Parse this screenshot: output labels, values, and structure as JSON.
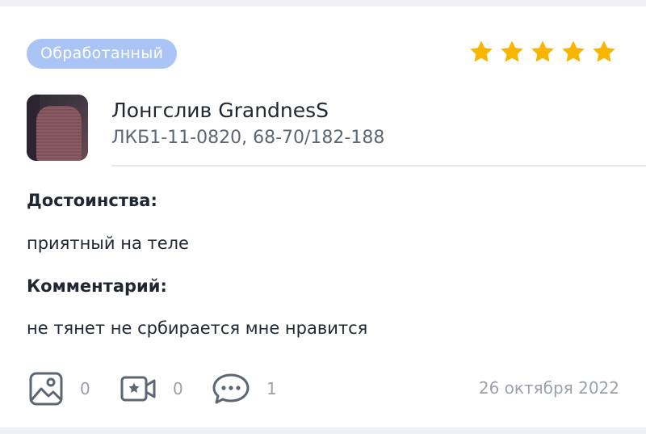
{
  "review": {
    "status": "Обработанный",
    "rating": 5,
    "rating_color": "#f7b500",
    "product": {
      "name": "Лонгслив GrandnesS",
      "code": "ЛКБ1-11-0820, 68-70/182-188"
    },
    "advantages_title": "Достоинства:",
    "advantages_text": "приятный на теле",
    "comment_title": "Комментарий:",
    "comment_text": "не тянет не србирается мне нравится",
    "stats": {
      "photos": {
        "icon": "image-icon",
        "count": "0"
      },
      "videos": {
        "icon": "video-icon",
        "count": "0"
      },
      "comments": {
        "icon": "comment-icon",
        "count": "1"
      }
    },
    "date": "26 октября 2022"
  }
}
